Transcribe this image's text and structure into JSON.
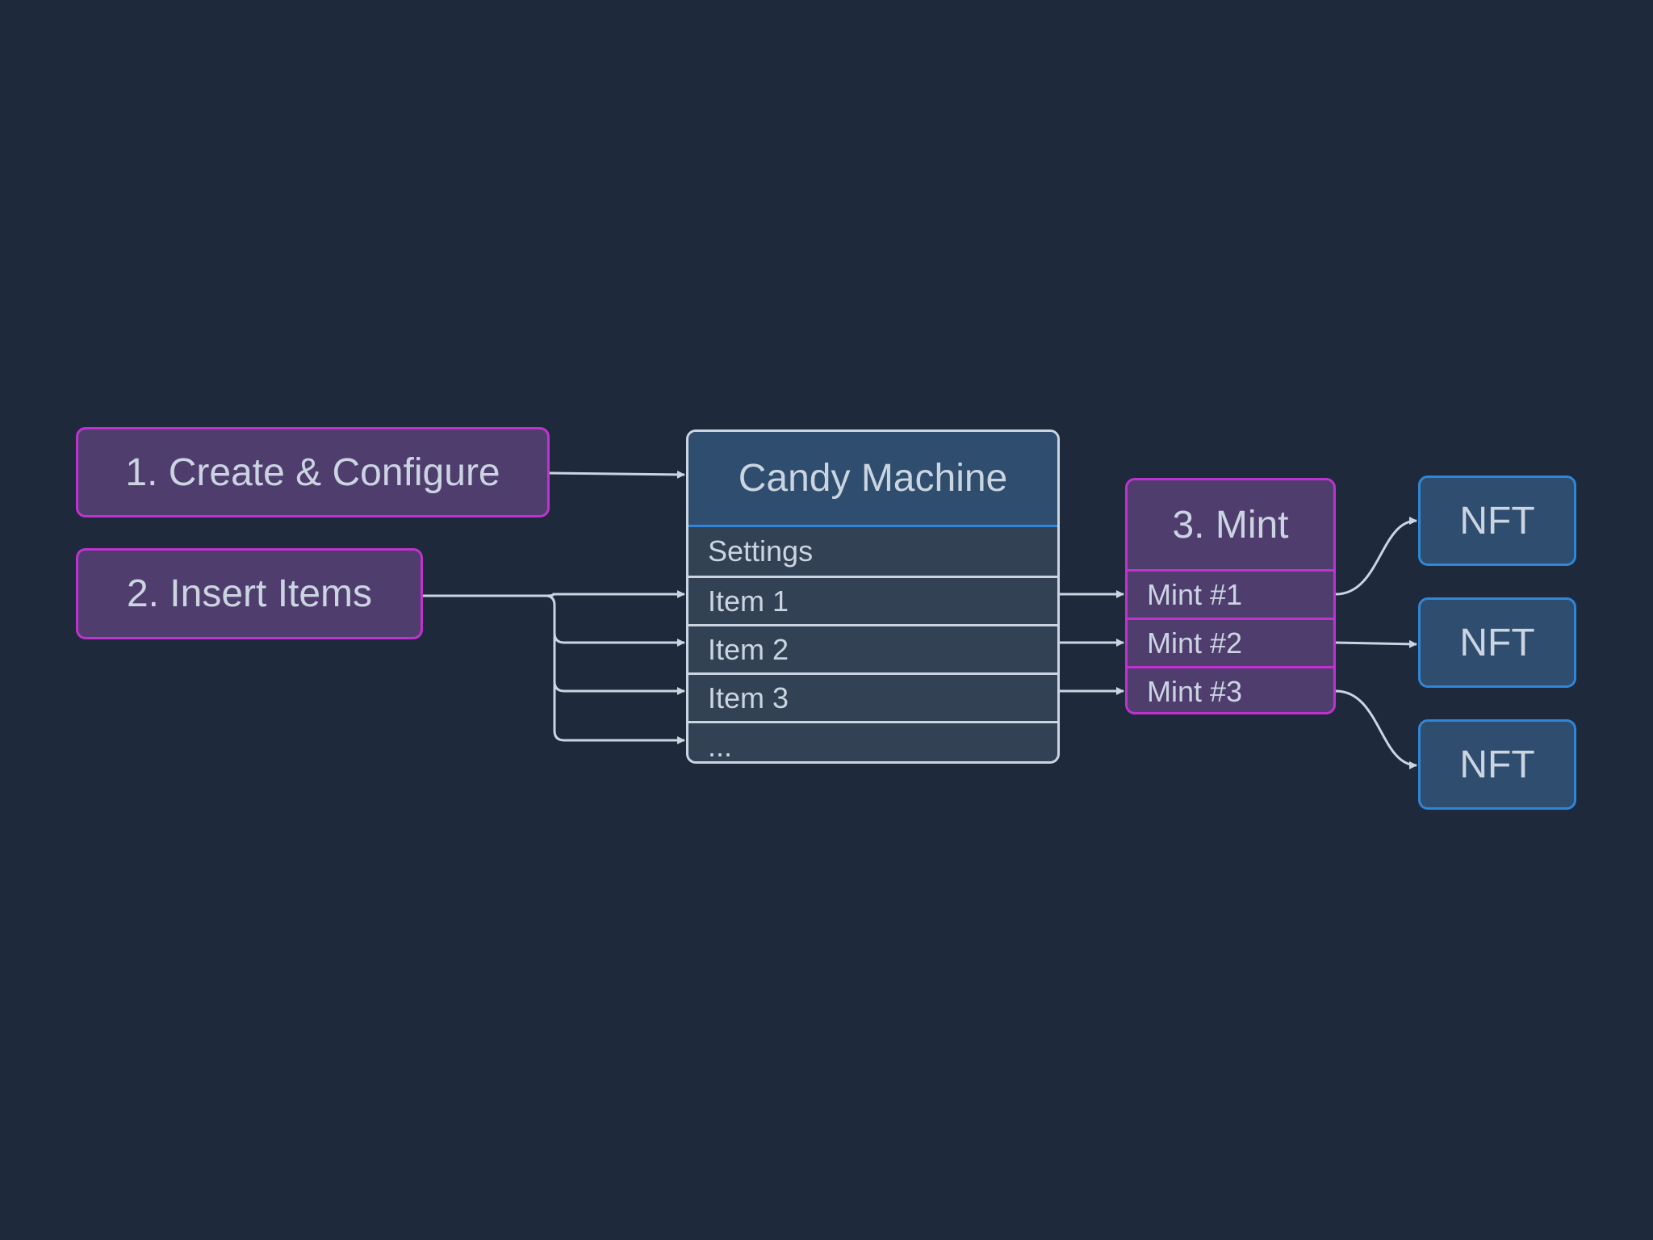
{
  "diagram": {
    "steps": {
      "create": "1. Create & Configure",
      "insert": "2. Insert Items",
      "mint": "3. Mint"
    },
    "candy_machine": {
      "title": "Candy Machine",
      "rows": [
        "Settings",
        "Item 1",
        "Item 2",
        "Item 3",
        "..."
      ]
    },
    "mint_rows": [
      "Mint #1",
      "Mint #2",
      "Mint #3"
    ],
    "outputs": [
      "NFT",
      "NFT",
      "NFT"
    ],
    "colors": {
      "background": "#1e293b",
      "step_fill": "#4f3d6e",
      "step_border": "#c032d0",
      "entity_fill": "#2f4d6e",
      "entity_border": "#2f86d8",
      "edge": "#cbd5e1"
    }
  }
}
